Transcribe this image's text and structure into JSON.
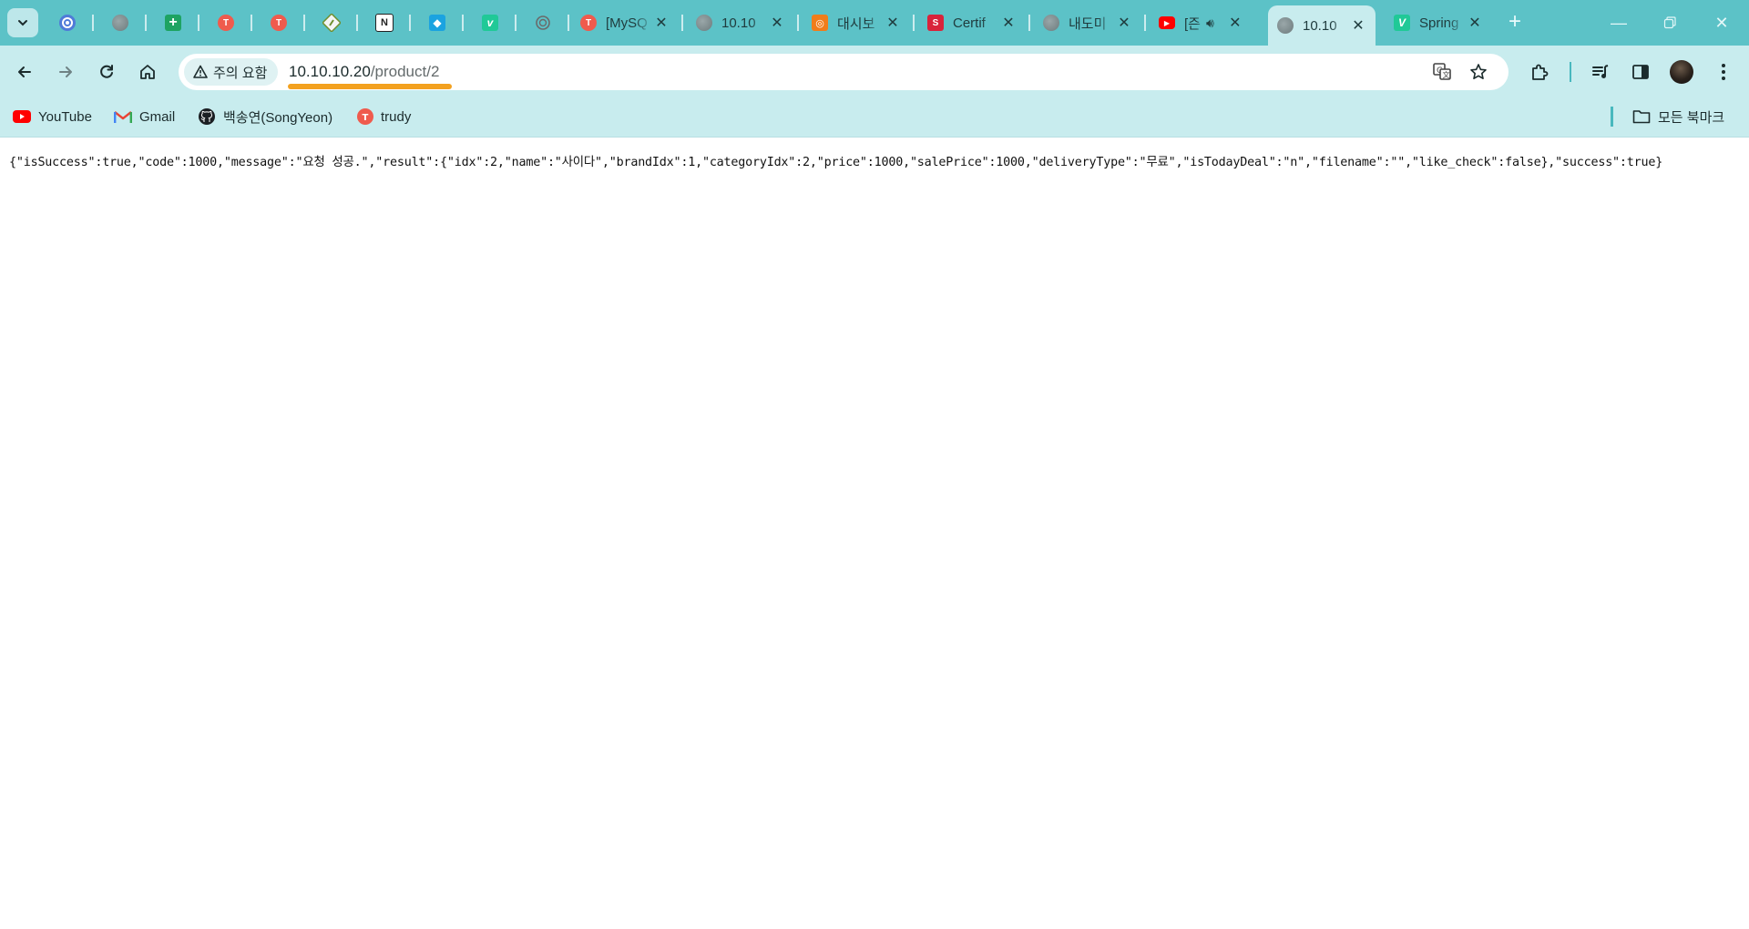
{
  "tabs": [
    {
      "kind": "pinned",
      "icon": "refresh-circle-icon",
      "color": "#4f7bd8"
    },
    {
      "kind": "pinned",
      "icon": "globe-icon",
      "color": "#7b8a8c"
    },
    {
      "kind": "pinned",
      "icon": "sheets-plus-icon",
      "color": "#1ea362"
    },
    {
      "kind": "pinned",
      "icon": "trudy-icon",
      "color": "#ef5b4d"
    },
    {
      "kind": "pinned",
      "icon": "trudy-icon",
      "color": "#ef5b4d"
    },
    {
      "kind": "pinned",
      "icon": "diamond-icon",
      "color": "#6f8f2f"
    },
    {
      "kind": "pinned",
      "icon": "notion-icon",
      "color": "#222222"
    },
    {
      "kind": "pinned",
      "icon": "cube-icon",
      "color": "#1ba3e0"
    },
    {
      "kind": "pinned",
      "icon": "velog-icon",
      "color": "#20c997"
    },
    {
      "kind": "pinned",
      "icon": "chatgpt-icon",
      "color": "#6a6a6a"
    }
  ],
  "open_tabs": [
    {
      "title": "[MySQ",
      "icon": "trudy-icon",
      "color": "#ef5b4d"
    },
    {
      "title": "10.10",
      "icon": "globe-icon",
      "color": "#7b8a8c"
    },
    {
      "title": "대시보",
      "icon": "dashboard-icon",
      "color": "#f07d1a"
    },
    {
      "title": "Certif",
      "icon": "cert-icon",
      "color": "#d9233b"
    },
    {
      "title": "내도미",
      "icon": "globe-icon",
      "color": "#7b8a8c"
    },
    {
      "title": "[즌",
      "icon": "youtube-icon",
      "color": "#ff0000",
      "audio": true
    },
    {
      "title": "10.10",
      "icon": "globe-icon",
      "color": "#7b8a8c",
      "active": true
    },
    {
      "title": "Spring",
      "icon": "velog-icon",
      "color": "#20c997"
    }
  ],
  "toolbar": {
    "security_label": "주의 요함",
    "url_host": "10.10.10.20",
    "url_path": "/product/2"
  },
  "bookmarks": [
    {
      "label": "YouTube",
      "icon": "youtube-icon"
    },
    {
      "label": "Gmail",
      "icon": "gmail-icon"
    },
    {
      "label": "백송연(SongYeon)",
      "icon": "github-icon"
    },
    {
      "label": "trudy",
      "icon": "trudy-icon"
    }
  ],
  "all_bookmarks_label": "모든 북마크",
  "page": {
    "json_response": "{\"isSuccess\":true,\"code\":1000,\"message\":\"요청 성공.\",\"result\":{\"idx\":2,\"name\":\"사이다\",\"brandIdx\":1,\"categoryIdx\":2,\"price\":1000,\"salePrice\":1000,\"deliveryType\":\"무료\",\"isTodayDeal\":\"n\",\"filename\":\"\",\"like_check\":false},\"success\":true}"
  }
}
